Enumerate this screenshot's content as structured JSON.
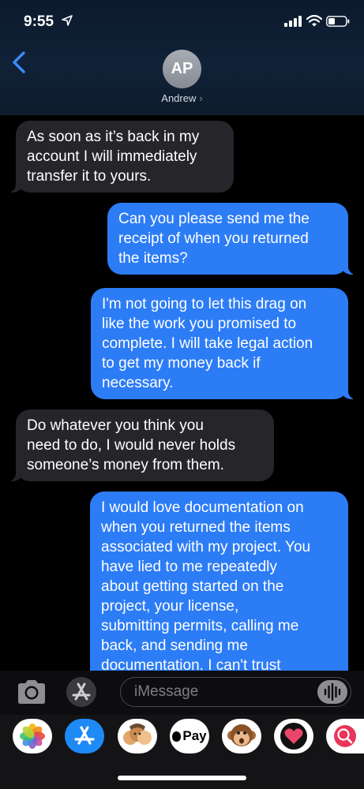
{
  "status": {
    "time": "9:55"
  },
  "contact": {
    "initials": "AP",
    "name": "Andrew",
    "chevron": "›"
  },
  "messages": [
    {
      "dir": "in",
      "text": "As soon as it’s back in my\naccount I will immediately\ntransfer it to yours."
    },
    {
      "dir": "out",
      "text": "Can you please send me the\nreceipt of when you returned\nthe items?"
    },
    {
      "dir": "out",
      "text": "I'm not going to let this drag on\nlike the work you promised to\ncomplete. I will take legal action\nto get my money back if\nnecessary."
    },
    {
      "dir": "in",
      "text": "Do whatever you think you\nneed to do, I would never holds\nsomeone’s money from them."
    },
    {
      "dir": "out",
      "text": "I would love documentation on\nwhen you returned the items\nassociated with my project. You\nhave lied to me repeatedly\nabout getting started on the\nproject, your license,\nsubmitting permits, calling me\nback, and sending me\ndocumentation. I can't trust"
    }
  ],
  "input": {
    "placeholder": "iMessage"
  },
  "drawer": {
    "apps": [
      {
        "name": "photos-app-icon"
      },
      {
        "name": "app-store-app-icon"
      },
      {
        "name": "memoji-app-icon"
      },
      {
        "name": "apple-pay-app-icon",
        "label": "Pay"
      },
      {
        "name": "animoji-app-icon"
      },
      {
        "name": "digital-touch-app-icon"
      },
      {
        "name": "web-search-app-icon"
      }
    ]
  },
  "colors": {
    "outgoing": "#2c7cf6",
    "incoming": "#26252a",
    "accent": "#3b8bf7"
  }
}
